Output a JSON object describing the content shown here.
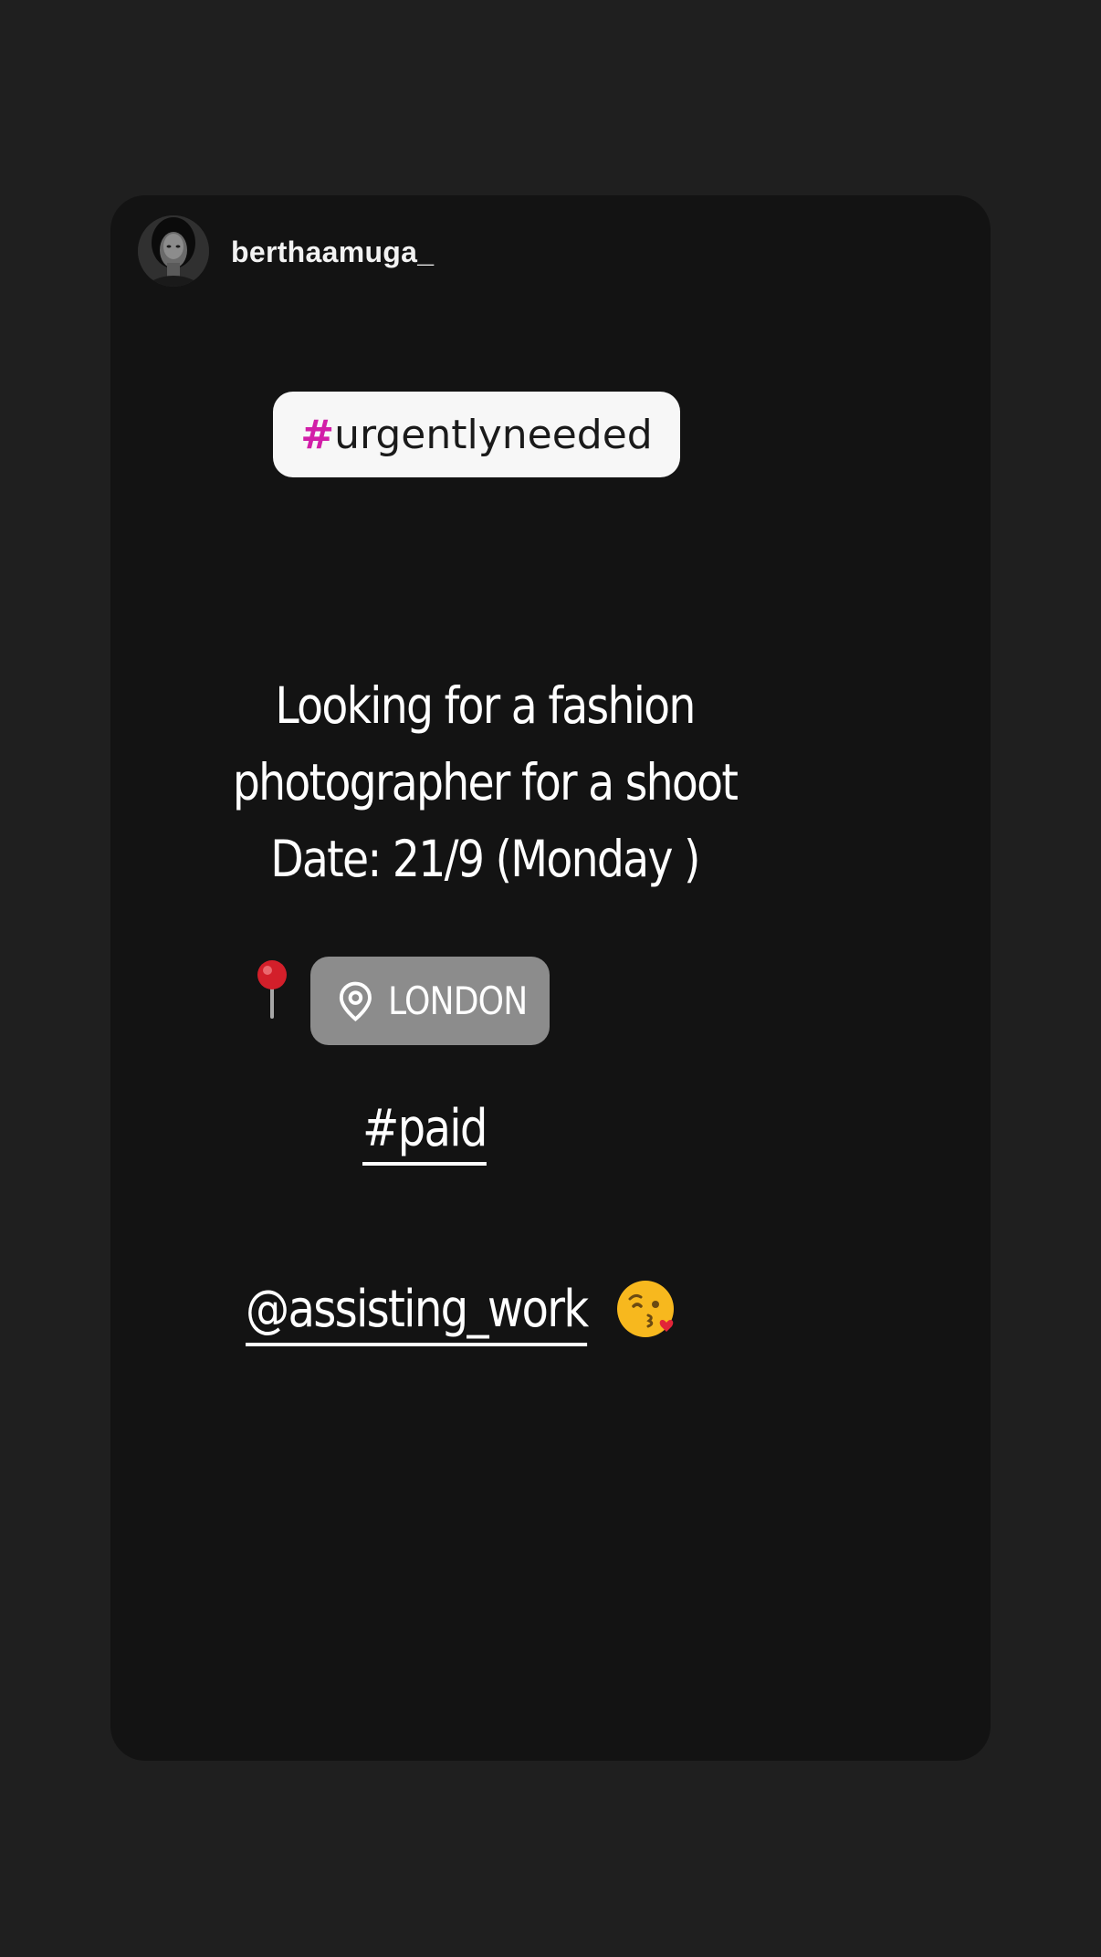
{
  "story": {
    "username": "berthaamuga_",
    "hashtag_sticker": {
      "hash": "#",
      "text": "urgentlyneeded",
      "hash_color": "#d21ea8"
    },
    "message_lines": [
      "Looking for a fashion",
      "photographer for a  shoot",
      "Date: 21/9 (Monday )"
    ],
    "location_sticker": {
      "icon": "location-pin-icon",
      "label": "LONDON"
    },
    "paid_tag": "#paid",
    "mention": "@assisting_work",
    "emojis": [
      "round-pushpin-emoji",
      "face-blowing-kiss-emoji"
    ]
  },
  "colors": {
    "page_background": "#1f1f1f",
    "card_background": "#131313",
    "sticker_background": "#f7f7f7",
    "location_background": "#8c8c8c"
  }
}
